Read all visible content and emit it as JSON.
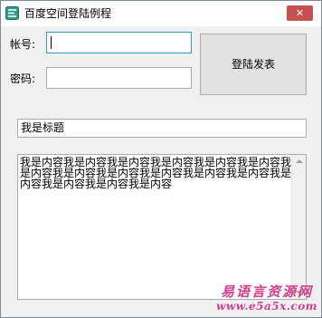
{
  "window": {
    "title": "百度空间登陆例程",
    "close_symbol": "✕"
  },
  "form": {
    "account_label": "帐号:",
    "account_value": "",
    "password_label": "密码:",
    "password_value": "",
    "login_button_label": "登陆发表",
    "title_value": "我是标题",
    "content_value": "我是内容我是内容我是内容我是内容我是内容我是内容我是内容我是内容我是内容我是内容我是内容我是内容我是内容我是内容我是内容我是内容"
  },
  "watermark": {
    "line1": "易语言资源网",
    "line2": "www.e5a5x.com"
  },
  "colors": {
    "close_button": "#c75050",
    "focus_border": "#3399cc",
    "watermark": "#d43f8d"
  },
  "icons": {
    "app_icon": "app-icon",
    "close_icon": "close-icon"
  }
}
